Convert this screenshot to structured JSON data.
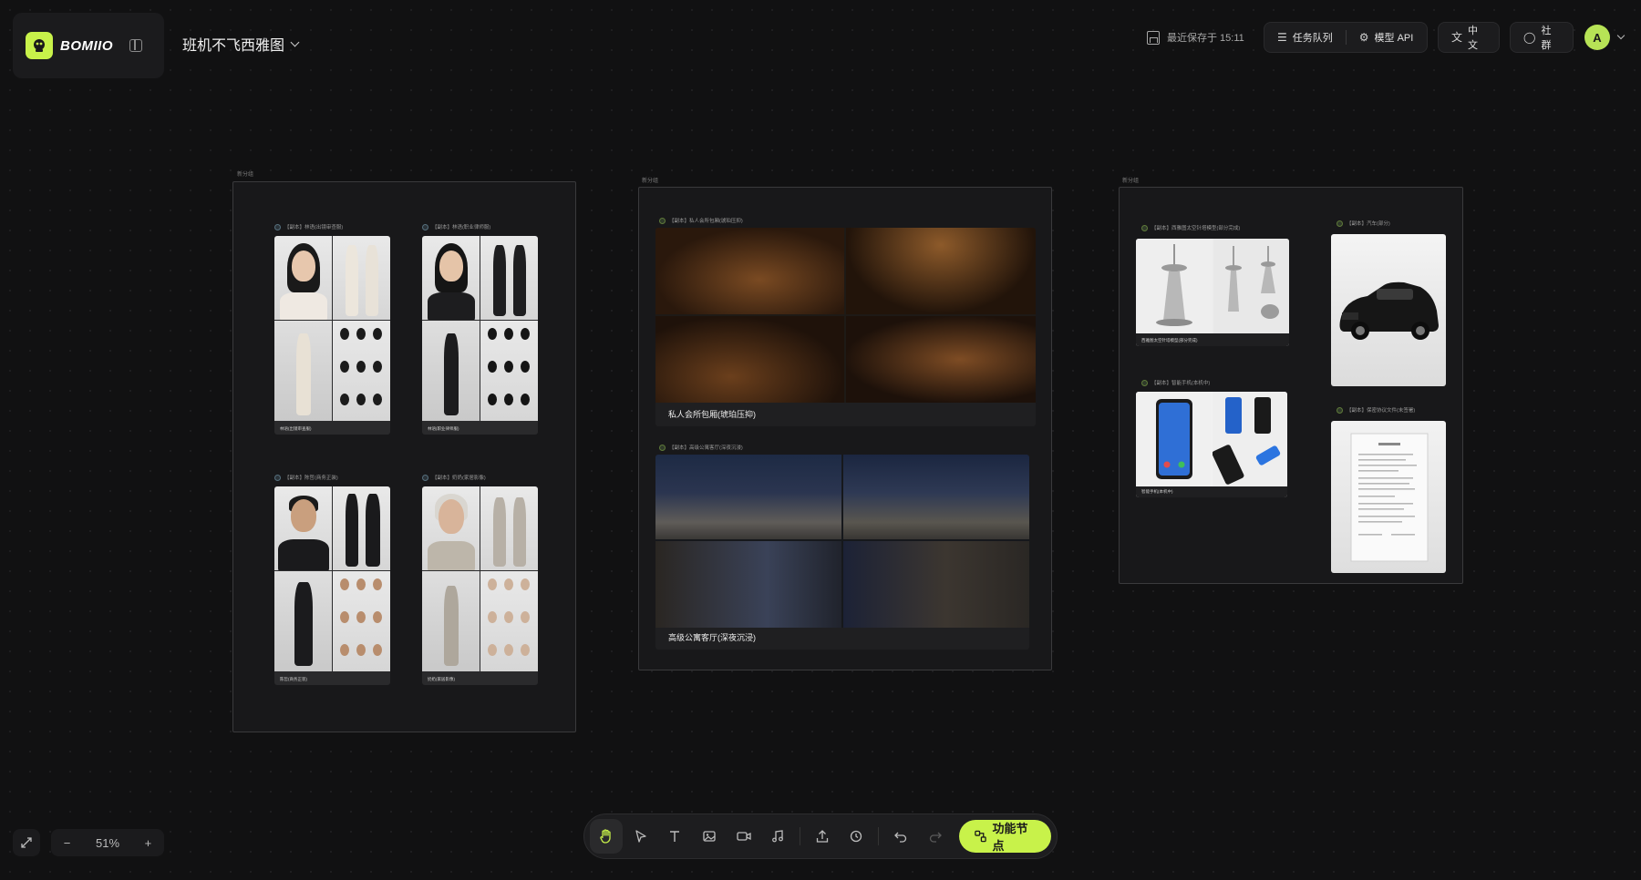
{
  "app": {
    "brand": "BOMIIO",
    "project_title": "班机不飞西雅图"
  },
  "header": {
    "save_status": "最近保存于 15:11",
    "task_queue_label": "任务队列",
    "model_api_label": "模型 API",
    "language_label": "中文",
    "community_label": "社群",
    "avatar_initial": "A"
  },
  "canvas": {
    "groups": [
      {
        "label": "新分组"
      },
      {
        "label": "新分组"
      },
      {
        "label": "新分组"
      }
    ],
    "characters": [
      {
        "title": "【副本】林语(出镜审查服)",
        "caption": "林语(出镜审查服)"
      },
      {
        "title": "【副本】林语(职业律师服)",
        "caption": "林语(职业律师服)"
      },
      {
        "title": "【副本】陈哲(商务正装)",
        "caption": "陈哲(商务正装)"
      },
      {
        "title": "【副本】奶奶(家居影像)",
        "caption": "奶奶(家居影像)"
      }
    ],
    "scenes": [
      {
        "title": "【副本】私人会所包厢(琥珀压抑)",
        "caption": "私人会所包厢(琥珀压抑)"
      },
      {
        "title": "【副本】高级公寓客厅(深夜沉浸)",
        "caption": "高级公寓客厅(深夜沉浸)"
      }
    ],
    "props": [
      {
        "title": "【副本】西雅图太空针塔模型(部分完成)",
        "caption": "西雅图太空针塔模型(部分完成)"
      },
      {
        "title": "【副本】汽车(部分)",
        "caption": ""
      },
      {
        "title": "【副本】智能手机(本机中)",
        "caption": "智能手机(本机中)"
      },
      {
        "title": "【副本】保密协议文件(未签署)",
        "caption": ""
      }
    ]
  },
  "toolbar": {
    "function_node_label": "功能节点"
  },
  "zoom": {
    "level": "51%"
  },
  "colors": {
    "accent": "#c8f24a",
    "background": "#111112"
  },
  "icons": {
    "hand": "hand-icon",
    "pointer": "pointer-icon",
    "text": "text-icon",
    "image": "image-icon",
    "video": "video-icon",
    "audio": "music-icon",
    "upload": "upload-icon",
    "history": "history-icon",
    "undo": "undo-icon",
    "redo": "redo-icon"
  }
}
